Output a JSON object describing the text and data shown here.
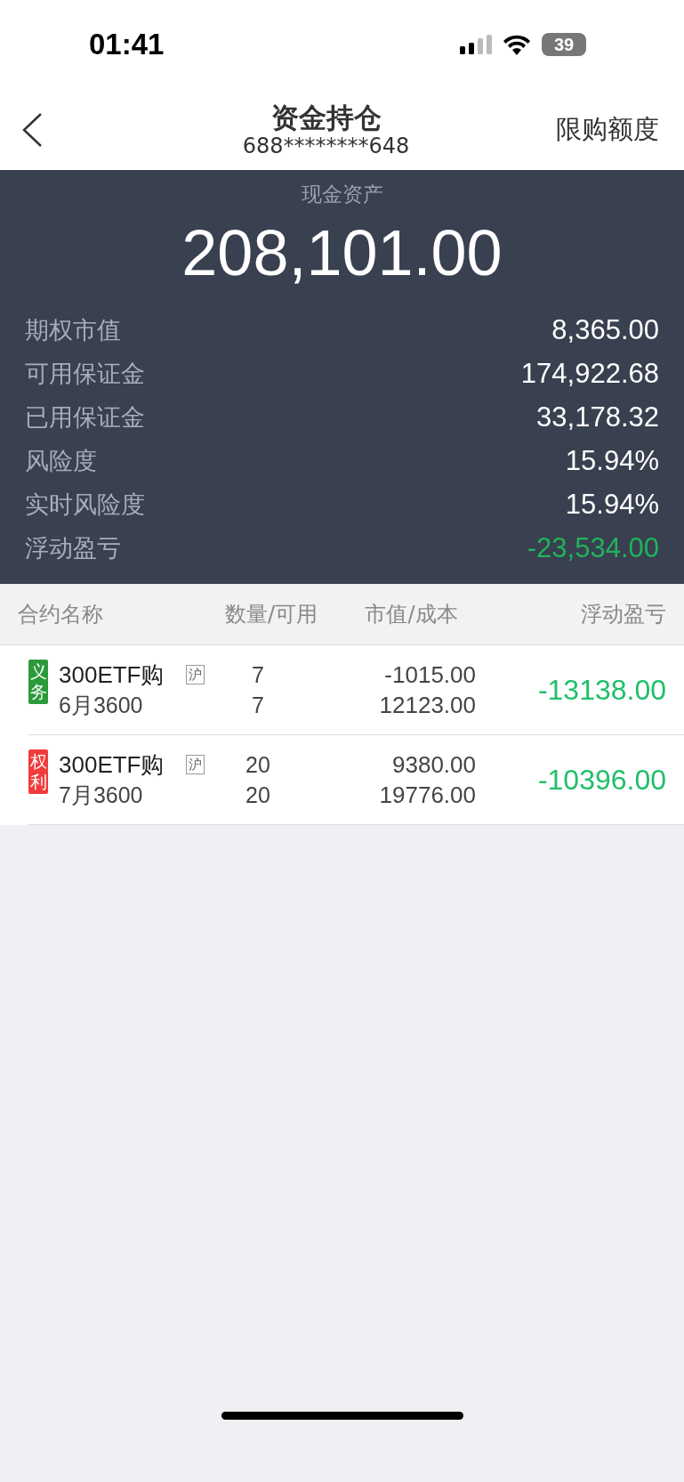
{
  "status_bar": {
    "time": "01:41",
    "battery": "39"
  },
  "header": {
    "title": "资金持仓",
    "account": "688********648",
    "action": "限购额度"
  },
  "summary": {
    "label": "现金资产",
    "value": "208,101.00",
    "items": [
      {
        "label": "期权市值",
        "value": "8,365.00",
        "color": "#ffffff"
      },
      {
        "label": "可用保证金",
        "value": "174,922.68",
        "color": "#ffffff"
      },
      {
        "label": "已用保证金",
        "value": "33,178.32",
        "color": "#ffffff"
      },
      {
        "label": "风险度",
        "value": "15.94%",
        "color": "#ffffff"
      },
      {
        "label": "实时风险度",
        "value": "15.94%",
        "color": "#ffffff"
      },
      {
        "label": "浮动盈亏",
        "value": "-23,534.00",
        "color": "#1fb45a"
      }
    ]
  },
  "table": {
    "columns": [
      "合约名称",
      "数量/可用",
      "市值/成本",
      "浮动盈亏"
    ],
    "rows": [
      {
        "tag": "义务",
        "color": "#2a9a3a",
        "name": "300ETF购",
        "detail": "6月3600",
        "market": "沪",
        "quantity": "7",
        "available": "7",
        "value": "-1015.00",
        "cost": "12123.00",
        "pnl": "-13138.00"
      },
      {
        "tag": "权利",
        "color": "#f03c3c",
        "name": "300ETF购",
        "detail": "7月3600",
        "market": "沪",
        "quantity": "20",
        "available": "20",
        "value": "9380.00",
        "cost": "19776.00",
        "pnl": "-10396.00"
      }
    ]
  }
}
